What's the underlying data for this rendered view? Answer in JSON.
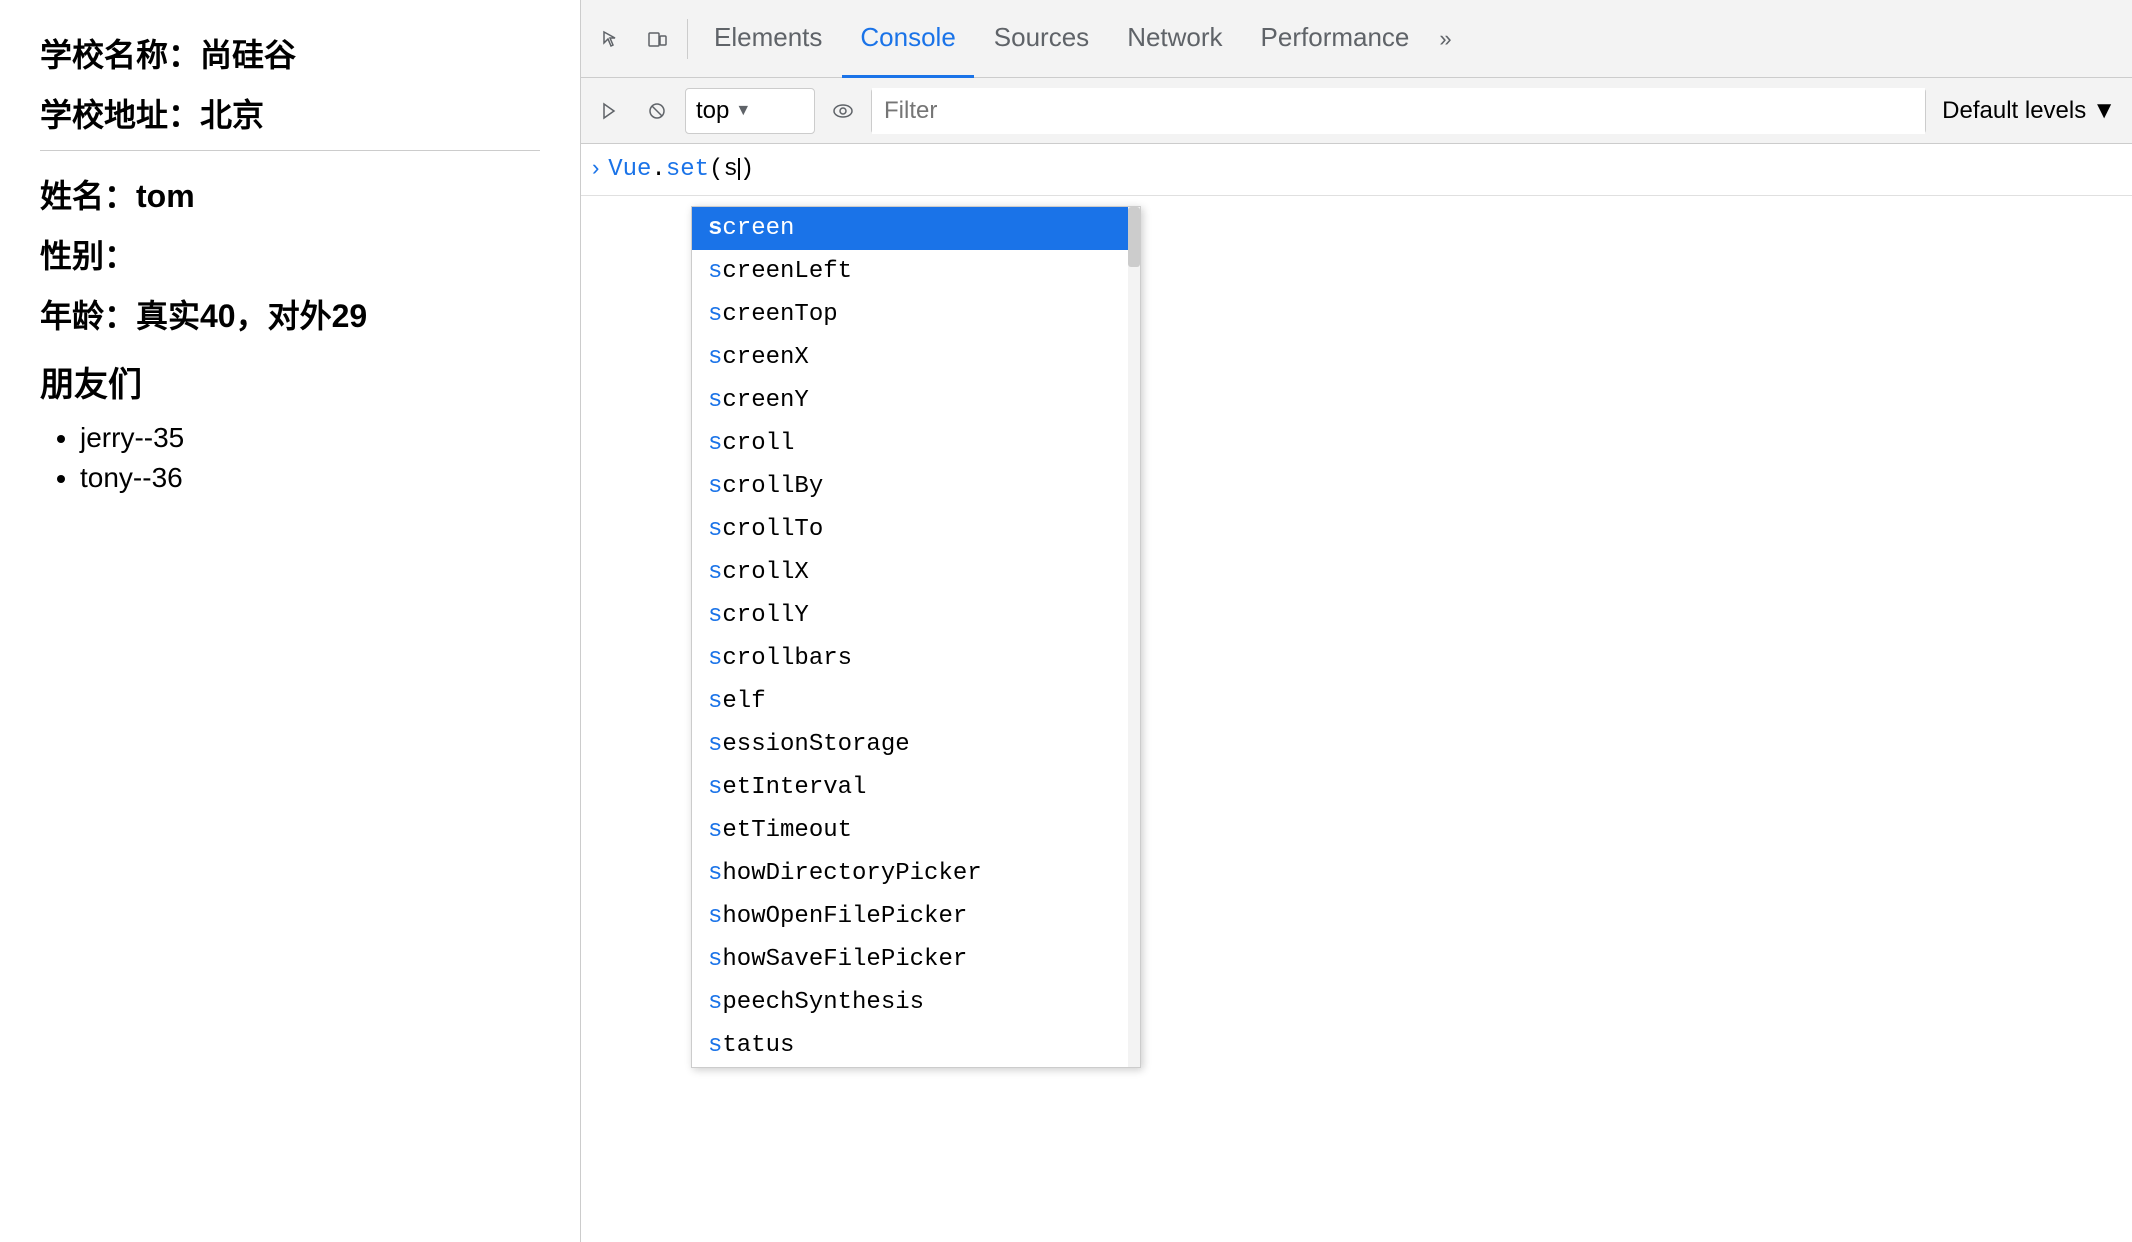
{
  "leftPanel": {
    "line1": "学校名称：尚硅谷",
    "line2": "学校地址：北京",
    "line3": "姓名：tom",
    "line4": "性别：",
    "line5": "年龄：真实40，对外29",
    "friendsTitle": "朋友们",
    "friends": [
      "jerry--35",
      "tony--36"
    ]
  },
  "devtools": {
    "tabs": [
      {
        "label": "Elements",
        "active": false
      },
      {
        "label": "Console",
        "active": true
      },
      {
        "label": "Sources",
        "active": false
      },
      {
        "label": "Network",
        "active": false
      },
      {
        "label": "Performance",
        "active": false
      }
    ],
    "moreTabsLabel": "»",
    "consoleBar": {
      "topSelector": "top",
      "filterPlaceholder": "Filter",
      "defaultLevels": "Default levels"
    },
    "consoleInput": "Vue.set(s",
    "promptSymbol": "›",
    "autocomplete": {
      "items": [
        {
          "text": "screen",
          "matchStart": 0,
          "matchEnd": 1,
          "selected": true
        },
        {
          "text": "screenLeft",
          "matchStart": 0,
          "matchEnd": 1,
          "selected": false
        },
        {
          "text": "screenTop",
          "matchStart": 0,
          "matchEnd": 1,
          "selected": false
        },
        {
          "text": "screenX",
          "matchStart": 0,
          "matchEnd": 1,
          "selected": false
        },
        {
          "text": "screenY",
          "matchStart": 0,
          "matchEnd": 1,
          "selected": false
        },
        {
          "text": "scroll",
          "matchStart": 0,
          "matchEnd": 1,
          "selected": false
        },
        {
          "text": "scrollBy",
          "matchStart": 0,
          "matchEnd": 1,
          "selected": false
        },
        {
          "text": "scrollTo",
          "matchStart": 0,
          "matchEnd": 1,
          "selected": false
        },
        {
          "text": "scrollX",
          "matchStart": 0,
          "matchEnd": 1,
          "selected": false
        },
        {
          "text": "scrollY",
          "matchStart": 0,
          "matchEnd": 1,
          "selected": false
        },
        {
          "text": "scrollbars",
          "matchStart": 0,
          "matchEnd": 1,
          "selected": false
        },
        {
          "text": "self",
          "matchStart": 0,
          "matchEnd": 1,
          "selected": false
        },
        {
          "text": "sessionStorage",
          "matchStart": 0,
          "matchEnd": 1,
          "selected": false
        },
        {
          "text": "setInterval",
          "matchStart": 0,
          "matchEnd": 2,
          "selected": false
        },
        {
          "text": "setTimeout",
          "matchStart": 0,
          "matchEnd": 2,
          "selected": false
        },
        {
          "text": "showDirectoryPicker",
          "matchStart": 0,
          "matchEnd": 2,
          "selected": false
        },
        {
          "text": "showOpenFilePicker",
          "matchStart": 0,
          "matchEnd": 2,
          "selected": false
        },
        {
          "text": "showSaveFilePicker",
          "matchStart": 0,
          "matchEnd": 2,
          "selected": false
        },
        {
          "text": "speechSynthesis",
          "matchStart": 0,
          "matchEnd": 2,
          "selected": false
        },
        {
          "text": "status",
          "matchStart": 0,
          "matchEnd": 1,
          "selected": false
        }
      ]
    }
  }
}
